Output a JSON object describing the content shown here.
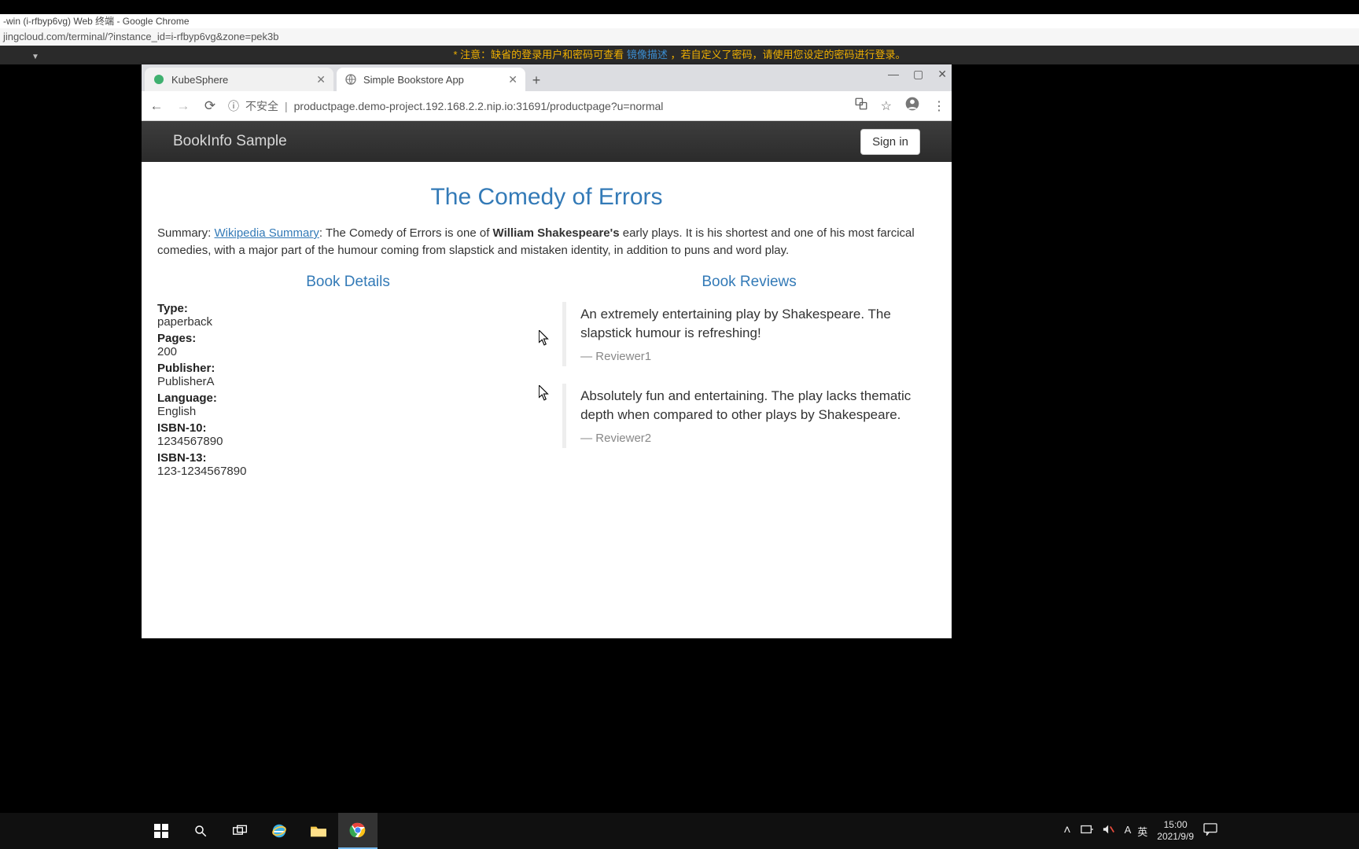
{
  "os": {
    "window_title": "-win (i-rfbyp6vg) Web 终端 - Google Chrome",
    "url": "jingcloud.com/terminal/?instance_id=i-rfbyp6vg&zone=pek3b"
  },
  "notice": {
    "prefix": "* 注意：缺省的登录用户和密码可查看 ",
    "link": "镜像描述",
    "suffix": "，若自定义了密码，请使用您设定的密码进行登录。",
    "dropdown": "▼"
  },
  "chrome": {
    "tabs": [
      {
        "label": "KubeSphere",
        "active": false
      },
      {
        "label": "Simple Bookstore App",
        "active": true
      }
    ],
    "address": {
      "insecure_label": "不安全",
      "url": "productpage.demo-project.192.168.2.2.nip.io:31691/productpage?u=normal"
    },
    "wincontrols": {
      "min": "—",
      "max": "▢",
      "close": "✕"
    }
  },
  "page": {
    "brand": "BookInfo Sample",
    "signin": "Sign in",
    "title": "The Comedy of Errors",
    "summary_label": "Summary:",
    "wiki_link": "Wikipedia Summary",
    "summary_pre": ": The Comedy of Errors is one of ",
    "summary_bold": "William Shakespeare's",
    "summary_post": " early plays. It is his shortest and one of his most farcical comedies, with a major part of the humour coming from slapstick and mistaken identity, in addition to puns and word play.",
    "details_heading": "Book Details",
    "reviews_heading": "Book Reviews",
    "details": {
      "type_label": "Type:",
      "type": "paperback",
      "pages_label": "Pages:",
      "pages": "200",
      "publisher_label": "Publisher:",
      "publisher": "PublisherA",
      "language_label": "Language:",
      "language": "English",
      "isbn10_label": "ISBN-10:",
      "isbn10": "1234567890",
      "isbn13_label": "ISBN-13:",
      "isbn13": "123-1234567890"
    },
    "reviews": [
      {
        "text": "An extremely entertaining play by Shakespeare. The slapstick humour is refreshing!",
        "reviewer": "Reviewer1"
      },
      {
        "text": "Absolutely fun and entertaining. The play lacks thematic depth when compared to other plays by Shakespeare.",
        "reviewer": "Reviewer2"
      }
    ]
  },
  "taskbar": {
    "tray": {
      "ime1": "A",
      "ime2": "英"
    },
    "time": "15:00",
    "date": "2021/9/9"
  }
}
